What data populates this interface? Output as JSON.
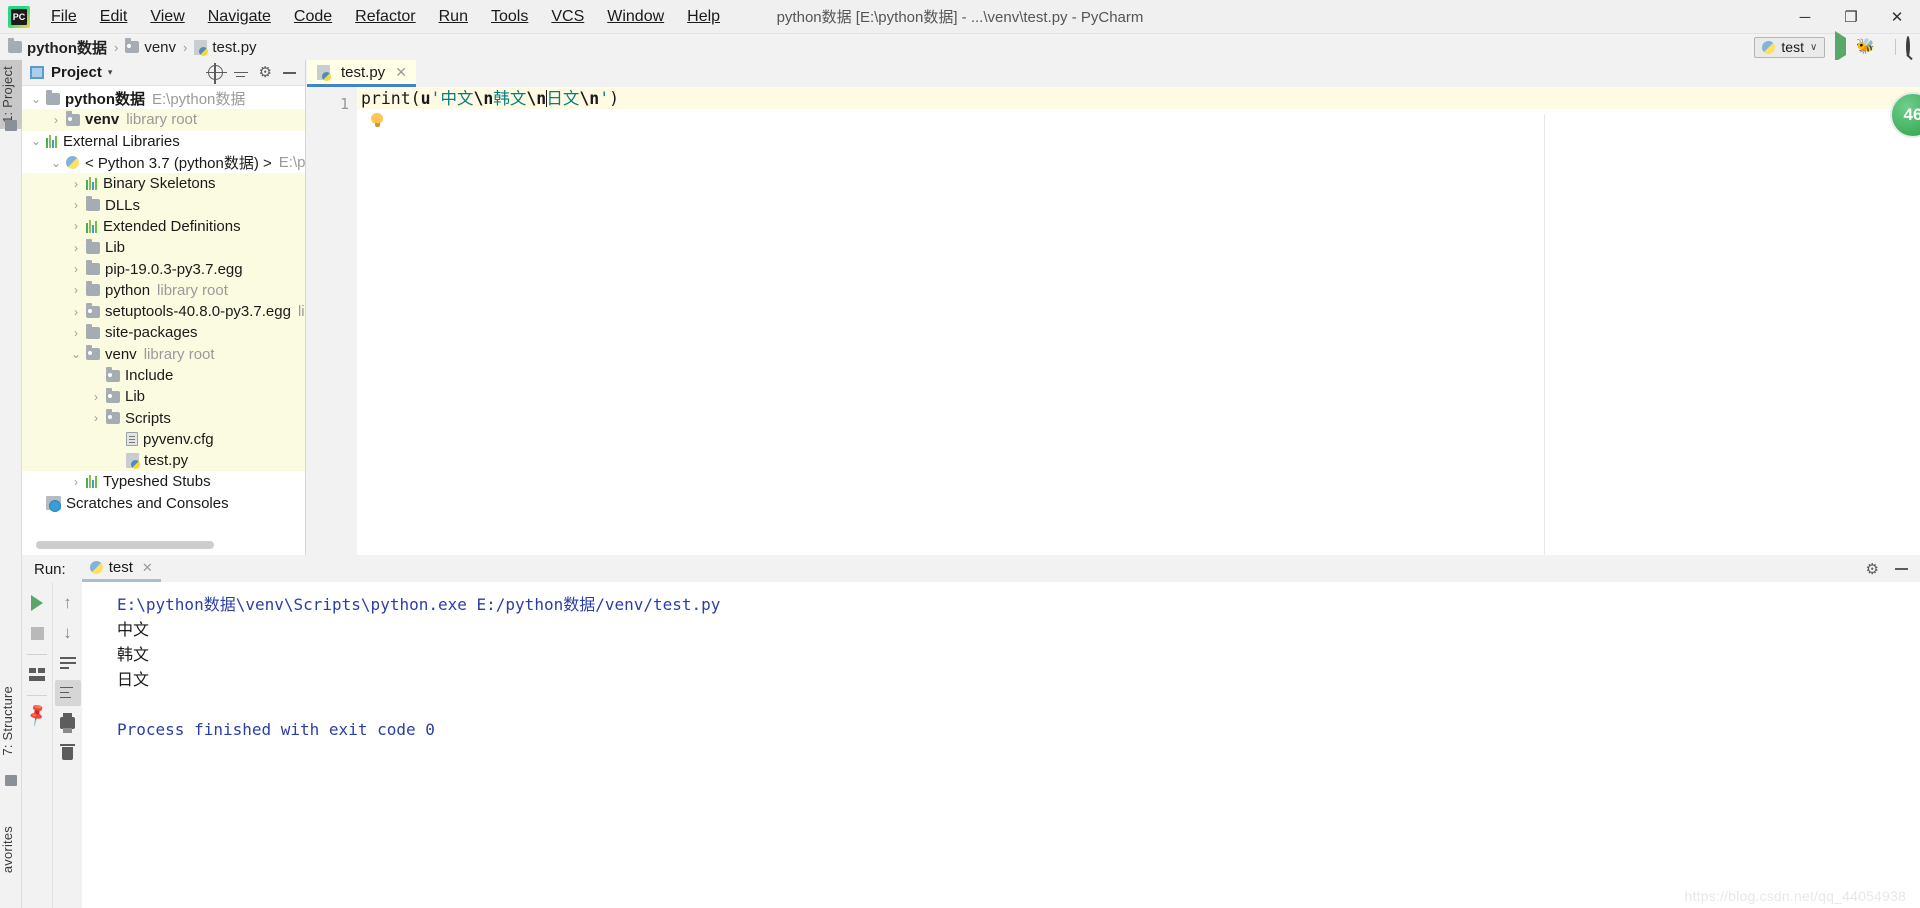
{
  "window": {
    "title": "python数据 [E:\\python数据] - ...\\venv\\test.py - PyCharm",
    "minimize": "─",
    "maximize": "❐",
    "close": "✕"
  },
  "menu": [
    {
      "label": "File"
    },
    {
      "label": "Edit"
    },
    {
      "label": "View"
    },
    {
      "label": "Navigate"
    },
    {
      "label": "Code"
    },
    {
      "label": "Refactor"
    },
    {
      "label": "Run"
    },
    {
      "label": "Tools"
    },
    {
      "label": "VCS"
    },
    {
      "label": "Window"
    },
    {
      "label": "Help"
    }
  ],
  "breadcrumb": {
    "items": [
      {
        "label": "python数据",
        "icon": "folder-icon"
      },
      {
        "label": "venv",
        "icon": "library-folder-icon"
      },
      {
        "label": "test.py",
        "icon": "python-file-icon"
      }
    ],
    "separator": "›"
  },
  "toolbar_right": {
    "run_config_name": "test",
    "run_config_caret": "∨",
    "run_button": "run-icon",
    "debug_button": "debug-bug-icon",
    "stop_button": "stop-icon",
    "search_button": "search-icon"
  },
  "rail": {
    "left_top": "1: Project",
    "left_bottom_1": "7: Structure",
    "left_bottom_2": "avorites"
  },
  "project_panel": {
    "title": "Project",
    "caret": "▾",
    "tools": [
      "locate-target-icon",
      "collapse-all-icon",
      "settings-gear-icon",
      "hide-panel-icon"
    ],
    "tree": [
      {
        "label": "python数据",
        "hint": "E:\\python数据",
        "depth": 0,
        "twisty": "⌄",
        "icon": "folder",
        "bold": true,
        "hl": false
      },
      {
        "label": "venv",
        "hint": "library root",
        "depth": 1,
        "twisty": "›",
        "icon": "library-folder",
        "bold": true,
        "hl": true
      },
      {
        "label": "External Libraries",
        "hint": "",
        "depth": 0,
        "twisty": "⌄",
        "icon": "bars",
        "bold": false,
        "hl": false
      },
      {
        "label": "< Python 3.7 (python数据) >",
        "hint": "E:\\pytho",
        "depth": 1,
        "twisty": "⌄",
        "icon": "python",
        "bold": false,
        "hl": false
      },
      {
        "label": "Binary Skeletons",
        "hint": "",
        "depth": 2,
        "twisty": "›",
        "icon": "bars",
        "bold": false,
        "hl": true
      },
      {
        "label": "DLLs",
        "hint": "",
        "depth": 2,
        "twisty": "›",
        "icon": "folder",
        "bold": false,
        "hl": true
      },
      {
        "label": "Extended Definitions",
        "hint": "",
        "depth": 2,
        "twisty": "›",
        "icon": "bars",
        "bold": false,
        "hl": true
      },
      {
        "label": "Lib",
        "hint": "",
        "depth": 2,
        "twisty": "›",
        "icon": "folder",
        "bold": false,
        "hl": true
      },
      {
        "label": "pip-19.0.3-py3.7.egg",
        "hint": "",
        "depth": 2,
        "twisty": "›",
        "icon": "folder",
        "bold": false,
        "hl": true
      },
      {
        "label": "python",
        "hint": "library root",
        "depth": 2,
        "twisty": "›",
        "icon": "folder",
        "bold": false,
        "hl": true
      },
      {
        "label": "setuptools-40.8.0-py3.7.egg",
        "hint": "libra",
        "depth": 2,
        "twisty": "›",
        "icon": "library-folder",
        "bold": false,
        "hl": true
      },
      {
        "label": "site-packages",
        "hint": "",
        "depth": 2,
        "twisty": "›",
        "icon": "folder",
        "bold": false,
        "hl": true
      },
      {
        "label": "venv",
        "hint": "library root",
        "depth": 2,
        "twisty": "⌄",
        "icon": "library-folder",
        "bold": false,
        "hl": true
      },
      {
        "label": "Include",
        "hint": "",
        "depth": 3,
        "twisty": "",
        "icon": "library-folder",
        "bold": false,
        "hl": true
      },
      {
        "label": "Lib",
        "hint": "",
        "depth": 3,
        "twisty": "›",
        "icon": "library-folder",
        "bold": false,
        "hl": true
      },
      {
        "label": "Scripts",
        "hint": "",
        "depth": 3,
        "twisty": "›",
        "icon": "library-folder",
        "bold": false,
        "hl": true
      },
      {
        "label": "pyvenv.cfg",
        "hint": "",
        "depth": 4,
        "twisty": "",
        "icon": "cfg",
        "bold": false,
        "hl": true
      },
      {
        "label": "test.py",
        "hint": "",
        "depth": 4,
        "twisty": "",
        "icon": "python-file",
        "bold": false,
        "hl": true
      },
      {
        "label": "Typeshed Stubs",
        "hint": "",
        "depth": 2,
        "twisty": "›",
        "icon": "bars",
        "bold": false,
        "hl": false
      },
      {
        "label": "Scratches and Consoles",
        "hint": "",
        "depth": 0,
        "twisty": "",
        "icon": "scratch",
        "bold": false,
        "hl": false
      }
    ]
  },
  "editor": {
    "tab": {
      "label": "test.py",
      "close": "✕",
      "icon": "python-file-icon"
    },
    "line_number": "1",
    "code": {
      "fn": "print",
      "open_paren": "(",
      "prefix": "u",
      "quote_open": "'",
      "seg1": "中文",
      "esc1": "\\n",
      "seg2": "韩文",
      "esc2": "\\n",
      "seg3": "日文",
      "esc3": "\\n",
      "quote_close": "'",
      "close_paren": ")"
    },
    "intention_bulb": "lightbulb-icon",
    "inspection_badge": "46"
  },
  "run_panel": {
    "label": "Run:",
    "tab": {
      "label": "test",
      "close": "✕",
      "icon": "python-config-icon"
    },
    "header_tools": [
      "settings-gear-icon",
      "hide-panel-icon"
    ],
    "toolbar_left": [
      "rerun-icon",
      "stop-icon",
      "layout-icon",
      "pin-tab-icon"
    ],
    "toolbar_right": [
      "scroll-up-icon",
      "scroll-down-icon",
      "soft-wrap-icon",
      "scroll-to-end-icon",
      "print-icon",
      "clear-all-icon"
    ],
    "console_lines": [
      {
        "text": "E:\\python数据\\venv\\Scripts\\python.exe E:/python数据/venv/test.py",
        "style": "cmd"
      },
      {
        "text": "中文",
        "style": "out"
      },
      {
        "text": "韩文",
        "style": "out"
      },
      {
        "text": "日文",
        "style": "out"
      },
      {
        "text": "",
        "style": "out"
      },
      {
        "text": "Process finished with exit code 0",
        "style": "fin"
      }
    ]
  },
  "watermark": "https://blog.csdn.net/qq_44054938"
}
